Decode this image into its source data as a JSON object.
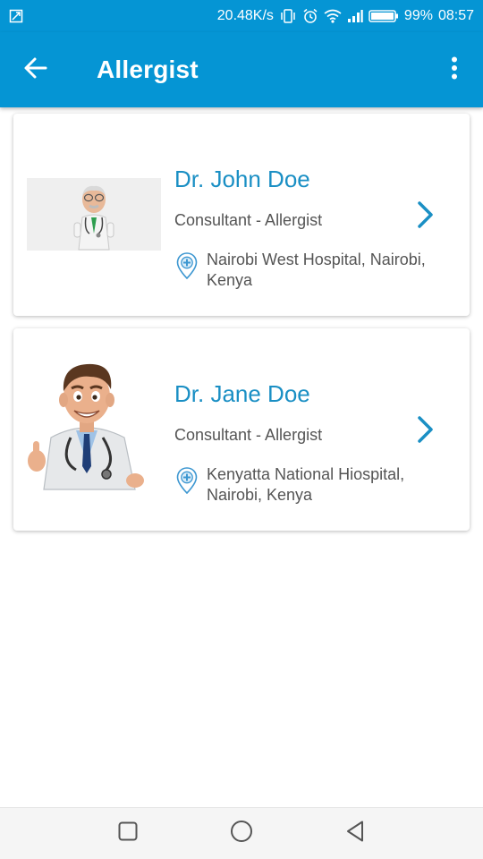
{
  "status_bar": {
    "speed": "20.48K/s",
    "battery": "99%",
    "time": "08:57",
    "icons": [
      "screenshot-icon",
      "vibrate-icon",
      "alarm-icon",
      "wifi-icon",
      "signal-icon",
      "battery-icon"
    ]
  },
  "app_bar": {
    "title": "Allergist",
    "back_icon": "arrow-left-icon",
    "menu_icon": "more-vert-icon"
  },
  "doctors": [
    {
      "name": "Dr. John Doe",
      "title": "Consultant - Allergist",
      "location": "Nairobi West Hospital, Nairobi, Kenya",
      "avatar": "elderly-doctor-avatar"
    },
    {
      "name": "Dr. Jane Doe",
      "title": "Consultant - Allergist",
      "location": "Kenyatta National Hiospital, Nairobi, Kenya",
      "avatar": "young-doctor-avatar"
    }
  ],
  "colors": {
    "primary": "#0595d4",
    "name_text": "#1a8fc4",
    "secondary_text": "#555555"
  },
  "nav_bar": {
    "icons": [
      "square-recents-icon",
      "circle-home-icon",
      "triangle-back-icon"
    ]
  }
}
